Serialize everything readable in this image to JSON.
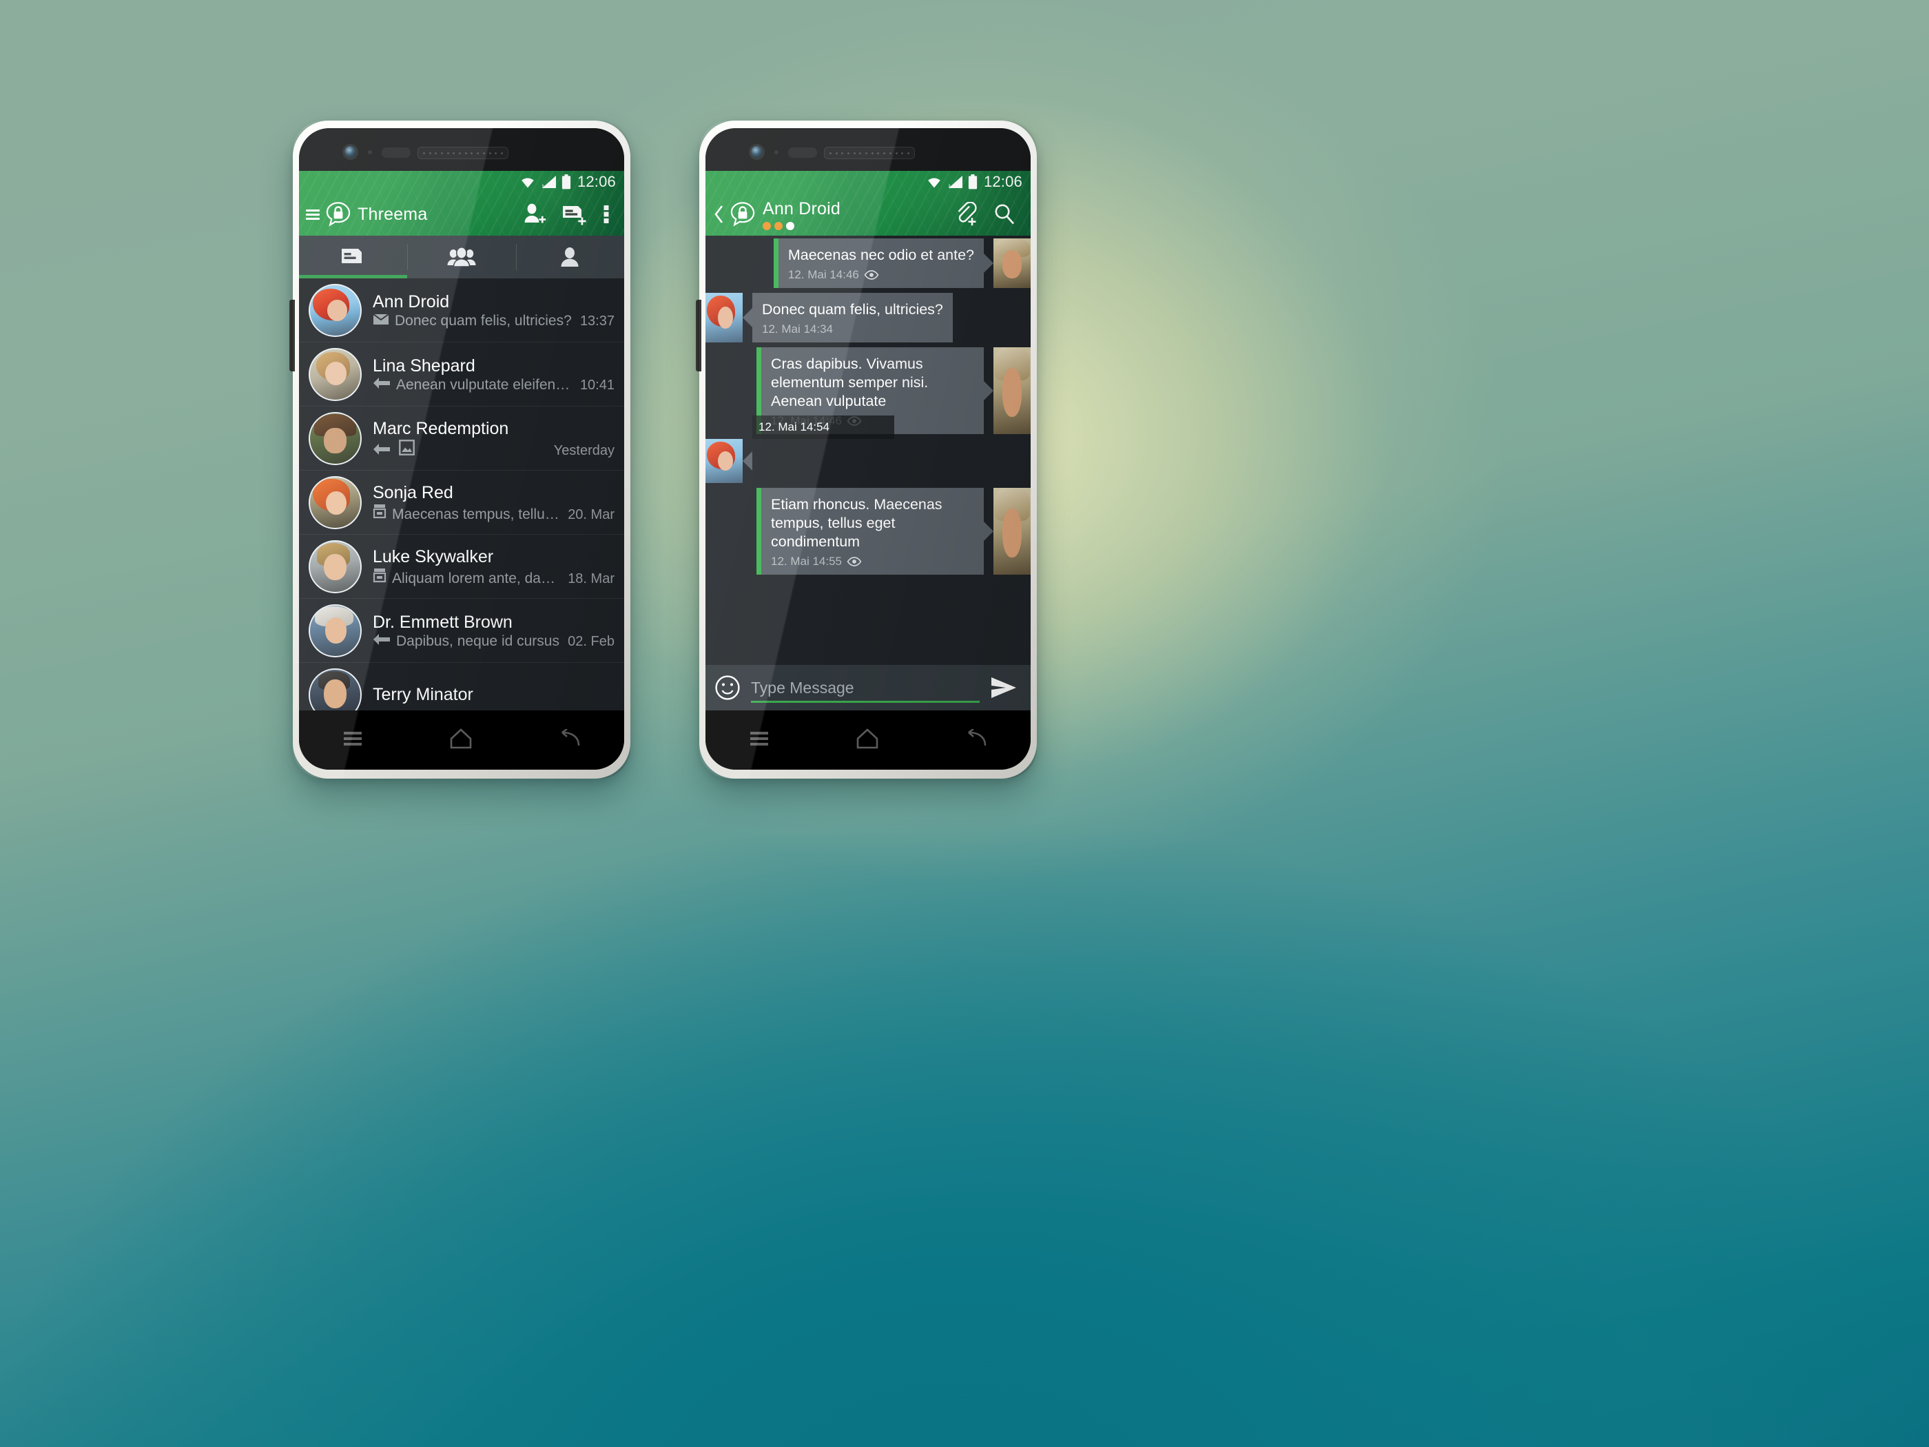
{
  "backdrop": {
    "colors": {
      "top_left": "#8cac9c",
      "center_glow": "#e8e9ba",
      "bottom": "#0a7183",
      "mid_teal": "#0d7886"
    }
  },
  "theme": {
    "accent_green": "#2f9e4c",
    "bubble_accent": "#37b24d",
    "appbar_green": "#17823f",
    "list_bg": "#1e2226",
    "tabbar_bg": "#3a4146",
    "bubble_bg": "#585f66",
    "composer_bg": "#31383d",
    "badge_orange": "#f0952a",
    "badge_white": "#ffffff"
  },
  "phone_left": {
    "status_bar": {
      "clock": "12:06",
      "icons": [
        "wifi-icon",
        "signal-icon",
        "battery-icon"
      ]
    },
    "action_bar": {
      "menu_icon": "hamburger-icon",
      "logo_icon": "threema-lock-bubble-logo",
      "title": "Threema",
      "actions": [
        {
          "icon": "add-contact-icon",
          "name": "add-contact-button"
        },
        {
          "icon": "new-chat-icon",
          "name": "new-chat-button"
        },
        {
          "icon": "overflow-menu-icon",
          "name": "overflow-menu-button"
        }
      ]
    },
    "tabs": [
      {
        "icon": "chats-icon",
        "name": "tab-chats",
        "active": true
      },
      {
        "icon": "groups-icon",
        "name": "tab-groups",
        "active": false
      },
      {
        "icon": "contacts-icon",
        "name": "tab-contacts",
        "active": false
      }
    ],
    "chats": [
      {
        "name": "Ann Droid",
        "preview": "Donec quam felis, ultricies?",
        "time": "13:37",
        "status_icon": "envelope-icon",
        "avatar": "p1"
      },
      {
        "name": "Lina Shepard",
        "preview": "Aenean vulputate eleifend telic...",
        "time": "10:41",
        "status_icon": "reply-arrow-icon",
        "avatar": "p2"
      },
      {
        "name": "Marc Redemption",
        "preview": "",
        "time": "Yesterday",
        "status_icon": "reply-arrow-icon",
        "extra_icon": "image-icon",
        "avatar": "p3"
      },
      {
        "name": "Sonja Red",
        "preview": "Maecenas tempus, tellus e...",
        "time": "20. Mar",
        "status_icon": "delivered-inbox-icon",
        "avatar": "p4"
      },
      {
        "name": "Luke Skywalker",
        "preview": "Aliquam lorem ante, dapib...",
        "time": "18. Mar",
        "status_icon": "delivered-inbox-icon",
        "avatar": "p5"
      },
      {
        "name": "Dr. Emmett Brown",
        "preview": "Dapibus, neque id cursus",
        "time": "02. Feb",
        "status_icon": "reply-arrow-icon",
        "avatar": "p6"
      },
      {
        "name": "Terry Minator",
        "preview": "",
        "time": "",
        "status_icon": "",
        "avatar": "p7"
      }
    ],
    "nav": [
      "recents-icon",
      "home-icon",
      "back-icon"
    ]
  },
  "phone_right": {
    "status_bar": {
      "clock": "12:06",
      "icons": [
        "wifi-icon",
        "signal-icon",
        "battery-icon"
      ]
    },
    "action_bar": {
      "back_icon": "back-chevron-icon",
      "logo_icon": "threema-lock-bubble-logo",
      "title": "Ann Droid",
      "trust_dots": [
        "#f0952a",
        "#f0952a",
        "#ffffff"
      ],
      "actions": [
        {
          "icon": "attach-icon",
          "name": "attach-button"
        },
        {
          "icon": "search-icon",
          "name": "search-button"
        }
      ]
    },
    "messages": [
      {
        "dir": "out",
        "text": "Maecenas nec odio et ante?",
        "time": "12. Mai 14:46",
        "read_icon": "eye-read-icon",
        "avatar": "tb"
      },
      {
        "dir": "in",
        "text": "Donec quam felis, ultricies?",
        "time": "12. Mai 14:34",
        "read_icon": "",
        "avatar": "ta"
      },
      {
        "dir": "out",
        "text": "Cras dapibus. Vivamus elementum semper nisi. Aenean vulputate",
        "time": "12. Mai 14:46",
        "read_icon": "eye-read-icon",
        "avatar": "tb"
      },
      {
        "dir": "in",
        "type": "image",
        "text": "",
        "time": "12. Mai 14:54",
        "read_icon": "",
        "avatar": "ta"
      },
      {
        "dir": "out",
        "text": "Etiam rhoncus. Maecenas tempus, tellus eget condimentum",
        "time": "12. Mai 14:55",
        "read_icon": "eye-read-icon",
        "avatar": "tb"
      }
    ],
    "composer": {
      "emoji_icon": "smiley-icon",
      "placeholder": "Type Message",
      "send_icon": "send-icon"
    },
    "nav": [
      "recents-icon",
      "home-icon",
      "back-icon"
    ]
  }
}
